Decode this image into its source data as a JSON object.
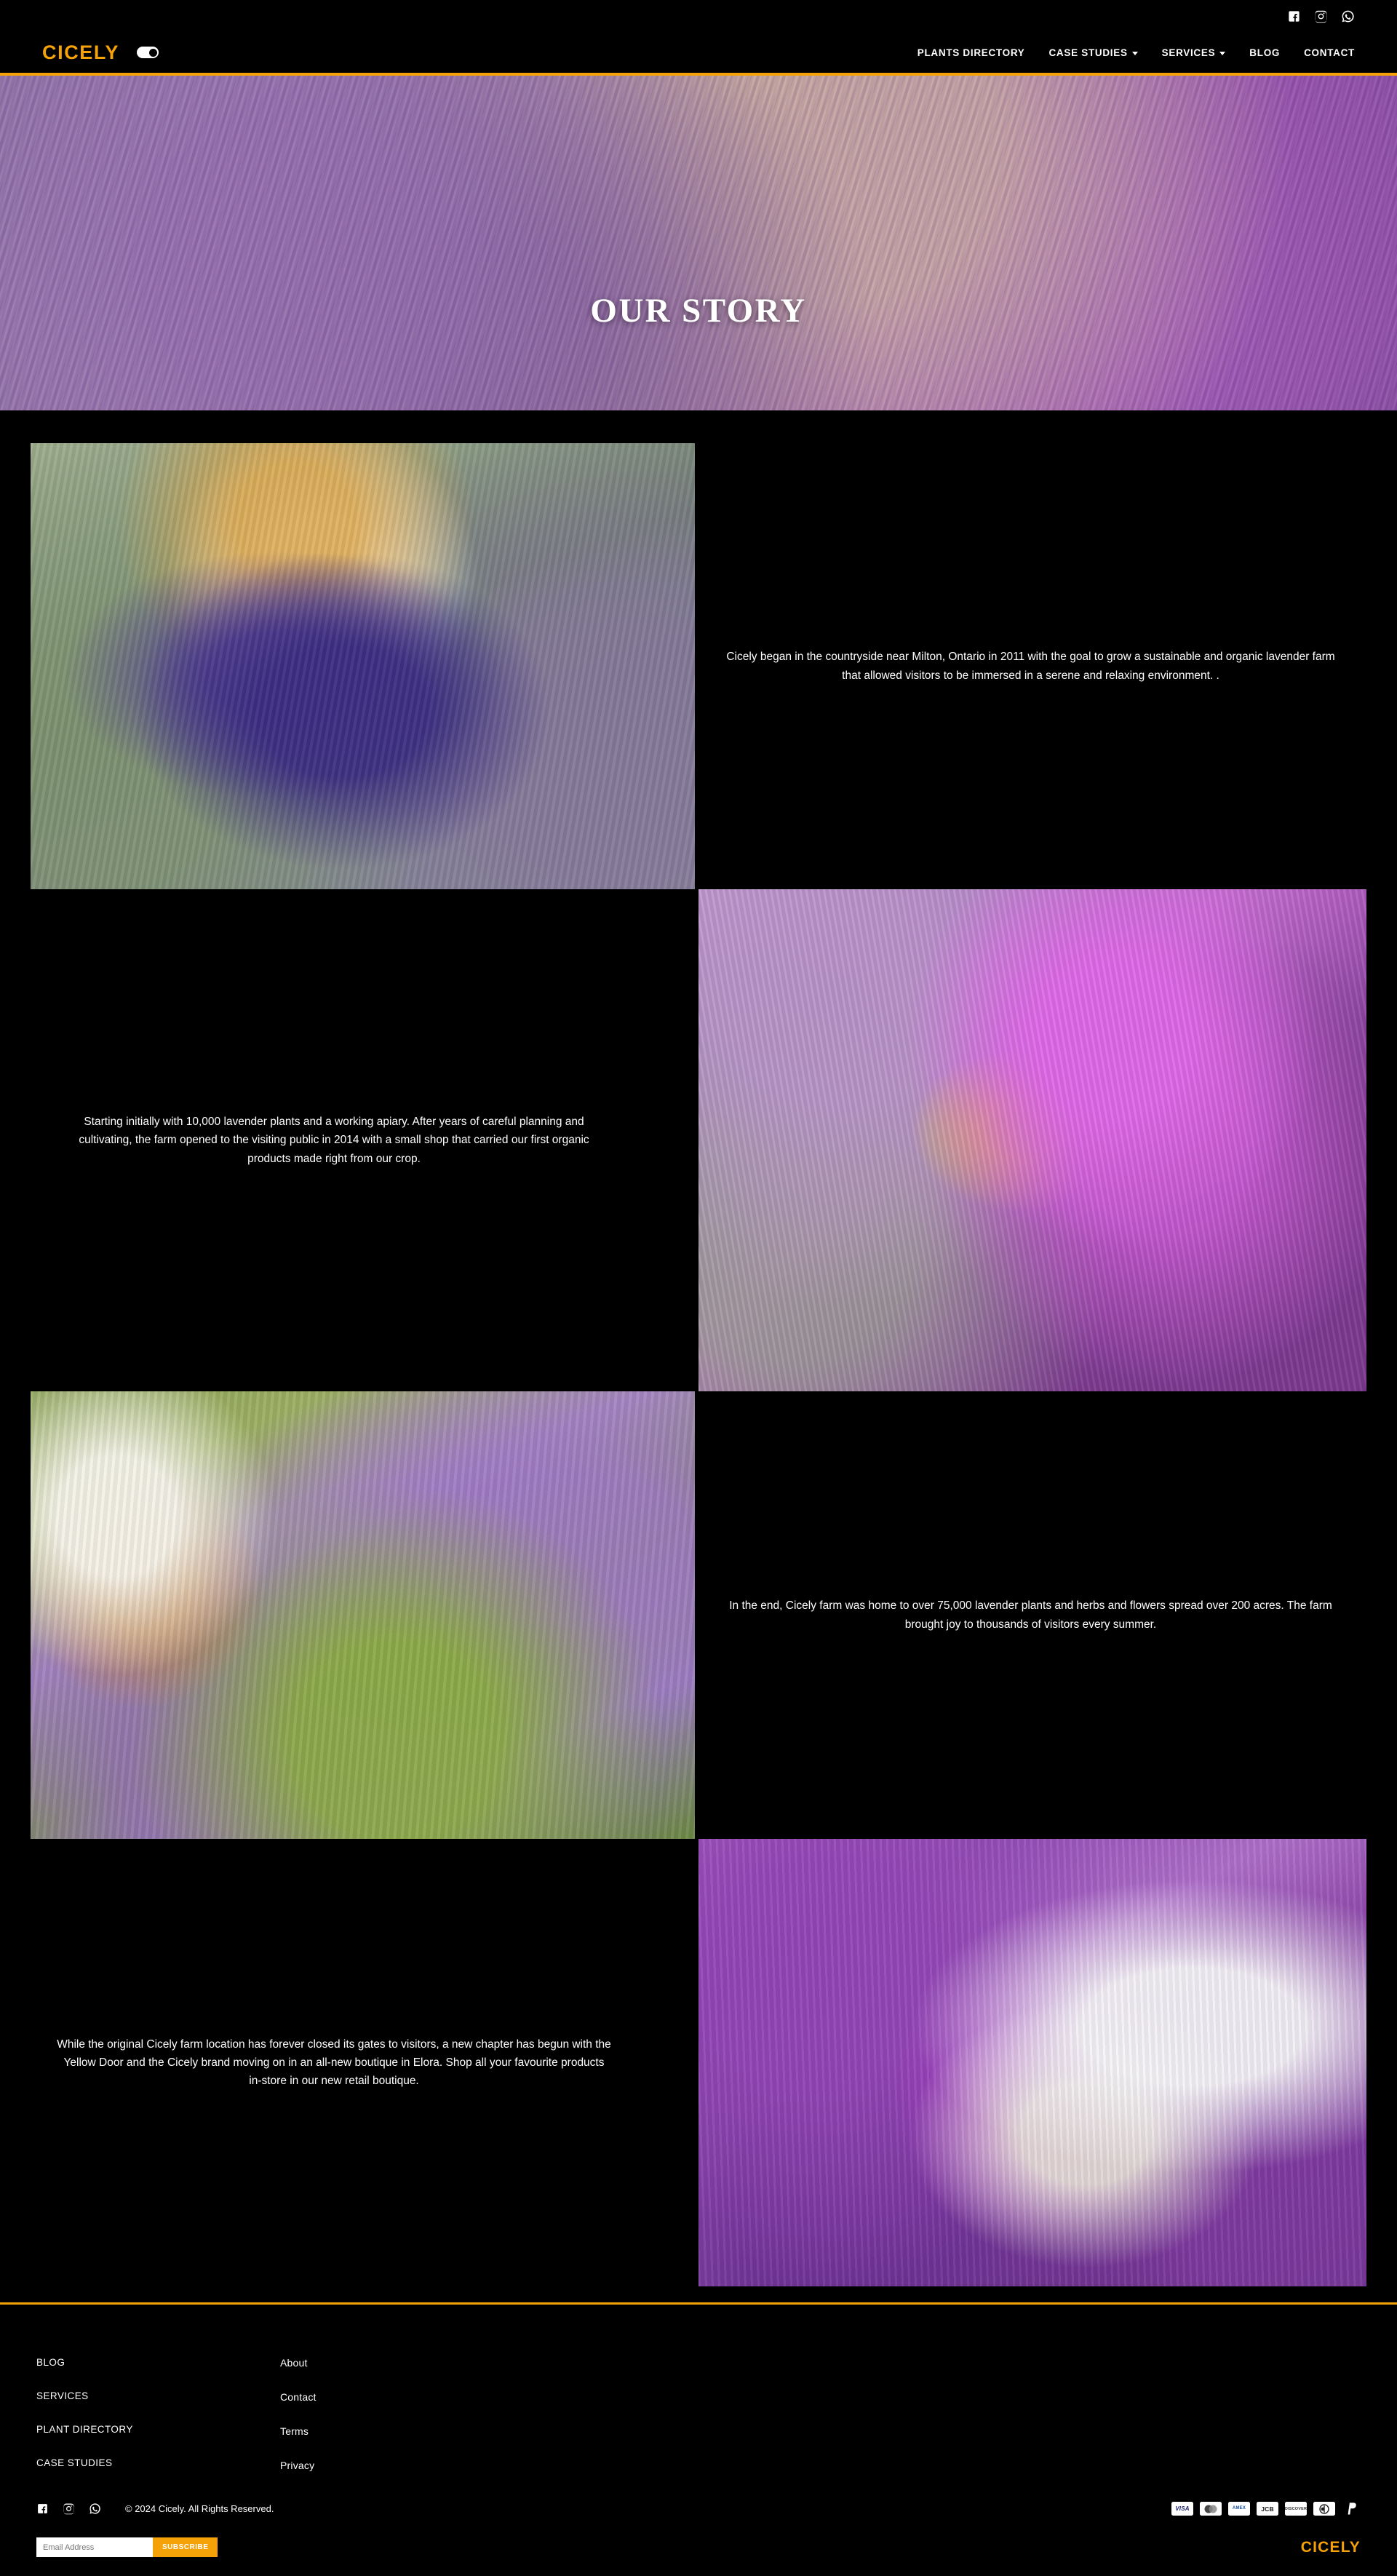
{
  "brand": {
    "name": "CICELY",
    "accent_color": "#f5a208"
  },
  "topbar": {
    "social": [
      {
        "name": "facebook-icon",
        "label": "Facebook"
      },
      {
        "name": "instagram-icon",
        "label": "Instagram"
      },
      {
        "name": "whatsapp-icon",
        "label": "WhatsApp"
      }
    ]
  },
  "nav": {
    "mode_toggle": "dark-mode-toggle",
    "items": [
      {
        "label": "PLANTS DIRECTORY",
        "has_dropdown": false
      },
      {
        "label": "CASE STUDIES",
        "has_dropdown": true
      },
      {
        "label": "SERVICES",
        "has_dropdown": true
      },
      {
        "label": "BLOG",
        "has_dropdown": false
      },
      {
        "label": "CONTACT",
        "has_dropdown": false
      }
    ]
  },
  "hero": {
    "title": "OUR STORY"
  },
  "story": {
    "blocks": [
      {
        "image_alt": "woman-carrying-lavender-basket",
        "text": "Cicely began in the countryside near Milton, Ontario in 2011 with the goal to grow a sustainable and organic lavender farm that allowed visitors to be immersed in a serene and relaxing environment. ."
      },
      {
        "image_alt": "bee-on-lavender-flower",
        "text": "Starting initially with 10,000 lavender plants and a working apiary. After years of careful planning and cultivating, the farm opened to the visiting public in 2014 with a small shop that carried our first organic products made right from our crop."
      },
      {
        "image_alt": "hat-and-camera-on-easel-in-lavender-field",
        "text": "In the end, Cicely farm was home to over 75,000 lavender plants and herbs and flowers spread over 200 acres. The farm brought joy to thousands of visitors every summer."
      },
      {
        "image_alt": "woman-in-white-dress-with-lavender-basket",
        "text": "While the original Cicely farm location has forever closed its gates to visitors, a new chapter has begun with the Yellow Door and the Cicely brand moving on in an all-new boutique in Elora. Shop all your favourite products in-store in our new retail boutique."
      }
    ]
  },
  "footer": {
    "column_one": [
      {
        "label": "BLOG"
      },
      {
        "label": "SERVICES"
      },
      {
        "label": "PLANT DIRECTORY"
      },
      {
        "label": "CASE STUDIES"
      }
    ],
    "column_two": [
      {
        "label": "About"
      },
      {
        "label": "Contact"
      },
      {
        "label": "Terms"
      },
      {
        "label": "Privacy"
      }
    ],
    "social": [
      {
        "name": "facebook-icon",
        "label": "Facebook"
      },
      {
        "name": "instagram-icon",
        "label": "Instagram"
      },
      {
        "name": "whatsapp-icon",
        "label": "WhatsApp"
      }
    ],
    "copyright": "© 2024 Cicely. All Rights Reserved.",
    "payments": [
      {
        "name": "visa-icon",
        "label": "VISA"
      },
      {
        "name": "mastercard-icon",
        "label": "mastercard"
      },
      {
        "name": "amex-icon",
        "label": "AMEX"
      },
      {
        "name": "jcb-icon",
        "label": "JCB"
      },
      {
        "name": "discover-icon",
        "label": "DISCOVER"
      },
      {
        "name": "diners-club-icon",
        "label": "Diners"
      },
      {
        "name": "paypal-icon",
        "label": "PayPal"
      }
    ],
    "newsletter": {
      "placeholder": "Email Address",
      "value": "",
      "button_label": "SUBSCRIBE"
    },
    "brand": "CICELY"
  }
}
